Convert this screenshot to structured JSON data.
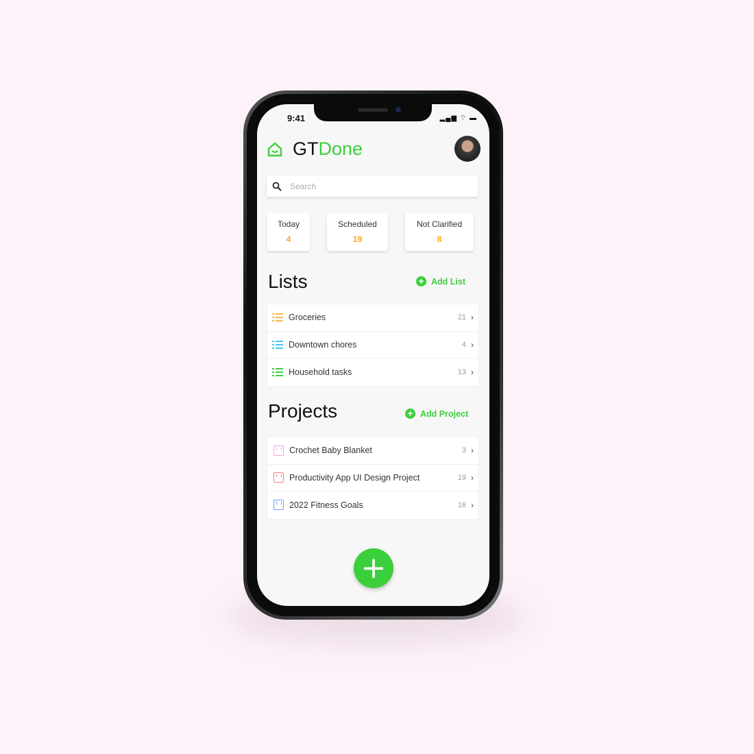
{
  "status": {
    "time": "9:41",
    "icons": "signal wifi battery"
  },
  "app": {
    "title_part1": "GT",
    "title_part2": "Done",
    "brand_color": "#3ccf3c",
    "accent_color": "#f7a91a"
  },
  "search": {
    "placeholder": "Search"
  },
  "stats": [
    {
      "label": "Today",
      "count": "4"
    },
    {
      "label": "Scheduled",
      "count": "19"
    },
    {
      "label": "Not Clarified",
      "count": "8"
    }
  ],
  "lists": {
    "title": "Lists",
    "add_label": "Add List",
    "items": [
      {
        "label": "Groceries",
        "count": "21",
        "color": "#f7b84b"
      },
      {
        "label": "Downtown chores",
        "count": "4",
        "color": "#3cc8f5"
      },
      {
        "label": "Household tasks",
        "count": "13",
        "color": "#3ccf3c"
      }
    ]
  },
  "projects": {
    "title": "Projects",
    "add_label": "Add Project",
    "items": [
      {
        "label": "Crochet Baby Blanket",
        "count": "3",
        "color": "#f5a0e0"
      },
      {
        "label": "Productivity App UI Design Project",
        "count": "19",
        "color": "#f08080"
      },
      {
        "label": "2022 Fitness Goals",
        "count": "16",
        "color": "#6a9ff5"
      }
    ]
  },
  "fab": {
    "label": "+"
  }
}
